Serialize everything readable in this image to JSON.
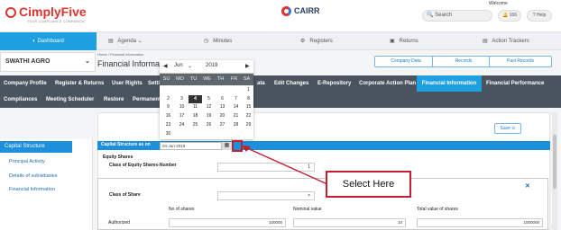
{
  "header": {
    "logo": "CimplyFive",
    "logo_tagline": "YOUR COMPLIANCE COMPANION",
    "product": "CAIRR",
    "welcome": "Welcome",
    "search_placeholder": "Search",
    "notif_count": "166",
    "help": "Help"
  },
  "nav": [
    "Dashboard",
    "Agenda",
    "Minutes",
    "Registers",
    "Returns",
    "Action Trackers"
  ],
  "company": "SWATHI AGRO",
  "breadcrumb": "Home  /  Financial Information",
  "page_title": "Financial Informa",
  "header_buttons": [
    "Company Data",
    "Records",
    "Past Records"
  ],
  "menu_row1": [
    "Company Profile",
    "Register & Returns",
    "User Rights",
    "Setti",
    "ata",
    "Edit Changes",
    "E-Repository",
    "Corporate Action Plan",
    "Financial Information",
    "Financial Performance"
  ],
  "menu_row2": [
    "Compliances",
    "Meeting Scheduler",
    "Restore",
    "Permanent"
  ],
  "sidebar": [
    "Capital Structure",
    "Principal Activity",
    "Details of subsidiaries",
    "Financial Information"
  ],
  "save": "Save",
  "section": {
    "header": "Capital Structure as on",
    "date_value": "04-Jun-2019",
    "equity_shares": "Equity Shares",
    "class_number_label": "Class of Equity Shares-Number",
    "class_number_value": "1",
    "class_of_share_label": "Class of Share",
    "col_no_shares": "No of shares",
    "col_nominal": "Nominal value",
    "col_total": "Total value of shares",
    "authorized": "Authorized",
    "auth_shares": "100000",
    "auth_nominal": "10",
    "auth_total": "1000000"
  },
  "calendar": {
    "month": "Jun",
    "year": "2019",
    "days": [
      "SU",
      "MO",
      "TU",
      "WE",
      "TH",
      "FR",
      "SA"
    ],
    "weeks": [
      [
        "",
        "",
        "",
        "",
        "",
        "",
        "1"
      ],
      [
        "2",
        "3",
        "4",
        "5",
        "6",
        "7",
        "8"
      ],
      [
        "9",
        "10",
        "11",
        "12",
        "13",
        "14",
        "15"
      ],
      [
        "16",
        "17",
        "18",
        "19",
        "20",
        "21",
        "22"
      ],
      [
        "23",
        "24",
        "25",
        "26",
        "27",
        "28",
        "29"
      ],
      [
        "30",
        "",
        "",
        "",
        "",
        "",
        ""
      ]
    ],
    "selected": "4"
  },
  "callout": "Select Here",
  "colors": {
    "accent": "#1ea0e0",
    "menu": "#4a545e",
    "brand": "#e0342e",
    "callout": "#c02030"
  }
}
